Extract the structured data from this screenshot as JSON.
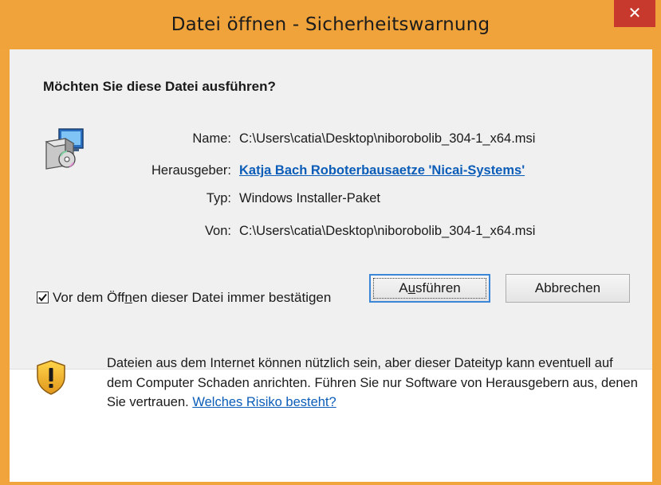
{
  "window": {
    "title": "Datei öffnen - Sicherheitswarnung",
    "close_label": "✕",
    "accent_color": "#f0a33a"
  },
  "question": "Möchten Sie diese Datei ausführen?",
  "file_icon": "installer-package-icon",
  "fields": {
    "name": {
      "label": "Name:",
      "value": "C:\\Users\\catia\\Desktop\\niborobolib_304-1_x64.msi"
    },
    "publisher": {
      "label": "Herausgeber:",
      "value": "Katja Bach Roboterbausaetze 'Nicai-Systems'"
    },
    "type": {
      "label": "Typ:",
      "value": "Windows Installer-Paket"
    },
    "from": {
      "label": "Von:",
      "value": "C:\\Users\\catia\\Desktop\\niborobolib_304-1_x64.msi"
    }
  },
  "buttons": {
    "run_pre": "A",
    "run_accel": "u",
    "run_post": "sführen",
    "cancel": "Abbrechen"
  },
  "checkbox": {
    "checked": true,
    "label_pre": "Vor dem Öff",
    "label_accel": "n",
    "label_post": "en dieser Datei immer bestätigen"
  },
  "warning": {
    "icon": "shield-warning-icon",
    "text": "Dateien aus dem Internet können nützlich sein, aber dieser Dateityp kann eventuell auf dem Computer Schaden anrichten. Führen Sie nur Software von Herausgebern aus, denen Sie vertrauen.",
    "link": "Welches Risiko besteht?"
  }
}
